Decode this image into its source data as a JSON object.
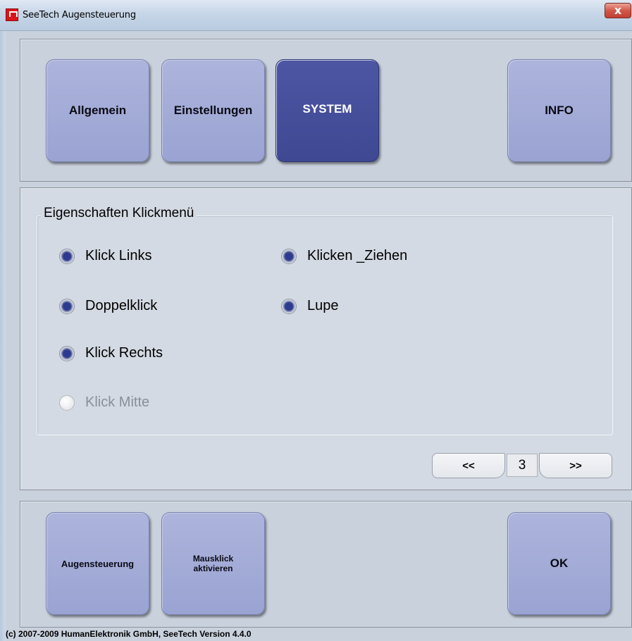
{
  "window": {
    "title": "SeeTech Augensteuerung",
    "close_label": "x"
  },
  "top_nav": {
    "allgemein": "Allgemein",
    "einstellungen": "Einstellungen",
    "system": "SYSTEM",
    "info": "INFO",
    "active": "SYSTEM"
  },
  "group": {
    "legend": "Eigenschaften Klickmenü",
    "options": [
      {
        "label": "Klick Links",
        "selected": true,
        "enabled": true
      },
      {
        "label": "Doppelklick",
        "selected": true,
        "enabled": true
      },
      {
        "label": "Klick Rechts",
        "selected": true,
        "enabled": true
      },
      {
        "label": "Klick Mitte",
        "selected": false,
        "enabled": false
      },
      {
        "label": "Klicken _Ziehen",
        "selected": true,
        "enabled": true
      },
      {
        "label": "Lupe",
        "selected": true,
        "enabled": true
      }
    ]
  },
  "pager": {
    "prev": "<<",
    "page": "3",
    "next": ">>"
  },
  "bottom": {
    "augensteuerung": "Augensteuerung",
    "mausklick_line1": "Mausklick",
    "mausklick_line2": "aktivieren",
    "ok": "OK"
  },
  "footer": "(c) 2007-2009 HumanElektronik GmbH, SeeTech Version 4.4.0",
  "colors": {
    "button": "#a3abd7",
    "active_button": "#444e9b",
    "background": "#c9d1dd"
  }
}
